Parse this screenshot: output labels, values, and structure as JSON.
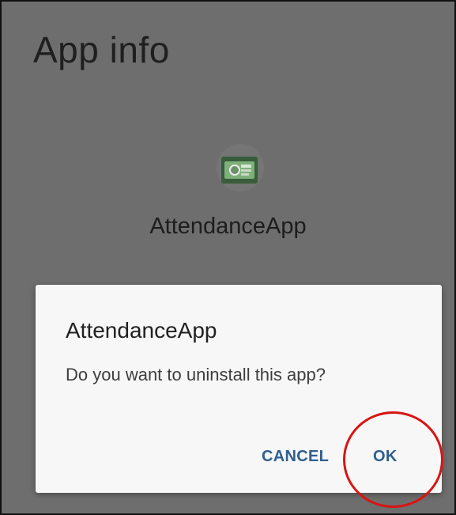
{
  "page": {
    "title": "App info"
  },
  "app": {
    "name": "AttendanceApp",
    "icon": "app-launcher-icon"
  },
  "dialog": {
    "title": "AttendanceApp",
    "message": "Do you want to uninstall this app?",
    "cancel_label": "CANCEL",
    "ok_label": "OK"
  },
  "colors": {
    "scrim": "#6e6e6e",
    "dialog_background": "#f7f7f7",
    "button_text": "#2f5f8e",
    "highlight": "#d81414"
  }
}
